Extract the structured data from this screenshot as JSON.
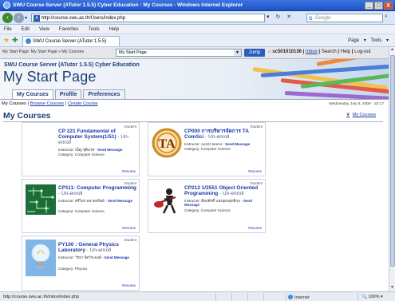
{
  "window": {
    "title": "SWU Course Server (ATutor 1.5.5) Cyber Education : My Courses - Windows Internet Explorer",
    "buttons": {
      "minimize": "_",
      "maximize": "□",
      "close": "X"
    }
  },
  "address": {
    "url": "http://course.swu.ac.th/Users/index.php",
    "search_placeholder": "Google"
  },
  "menu": [
    "File",
    "Edit",
    "View",
    "Favorites",
    "Tools",
    "Help"
  ],
  "favorites_bar": {
    "tab_label": "SWU Course Server (ATutor 1.5.5) Cyber Education (...",
    "commands": "Page ▾   Tools ▾"
  },
  "top_strip": {
    "breadcrumb": "My Start Page: My Start Page » My Courses",
    "jump_select_value": "My Start Page",
    "jump_button": "Jump",
    "username": "sc501010136",
    "links": [
      "Inbox",
      "Search",
      "Help",
      "Log-out"
    ]
  },
  "header": {
    "site_title": "SWU Course Server (ATutor 1.5.5) Cyber Education",
    "page_title": "My Start Page",
    "tabs": [
      "My Courses",
      "Profile",
      "Preferences"
    ]
  },
  "subnav": {
    "current": "My Courses",
    "links": [
      "Browse Courses",
      "Create Course"
    ],
    "date": "Wednesday July 8, 2009 - 23:17"
  },
  "main": {
    "title": "My Courses",
    "my_courses_link": "My Courses"
  },
  "courses": [
    {
      "role": "Student",
      "title": "CP 221 Fundamental of Computer System(1/51)",
      "unenroll": " - Un-enroll",
      "instructor": "Instructor: เพ็ญ ชุติมาศ - ",
      "send_message": "Send Message",
      "category": "Category: Computer Science",
      "resume": "Resume",
      "thumb": "none"
    },
    {
      "role": "Student",
      "title": "CP000 การบริหารจัดการ TA ComSci",
      "unenroll": " - Un-enroll",
      "instructor": "Instructor: cp101 teams - ",
      "send_message": "Send Message",
      "category": "Category: Computer Science",
      "resume": "Resume",
      "thumb": "ta-logo"
    },
    {
      "role": "Student",
      "title": "CP111: Computer Programming",
      "unenroll": " - Un-enroll",
      "instructor": "Instructor: ศรีไพร ฉลาดทรัพย์ - ",
      "send_message": "Send Message",
      "category": "Category: Computer Science",
      "resume": "Resume",
      "thumb": "circuit"
    },
    {
      "role": "Student",
      "title": "CP212 1/2551 Object Oriented Programming",
      "unenroll": " - Un-enroll",
      "instructor": "Instructor: ศิลปศักดิ์ แสงอุดมสุทธิกุล - ",
      "send_message": "Send Message",
      "category": "Category: Computer Science",
      "resume": "Resume",
      "thumb": "guitarist"
    },
    {
      "role": "Student",
      "title": "PY100 : General Physics Laboratory",
      "unenroll": " - Un-enroll",
      "instructor": "Instructor: วีรยา จิตวีระพงษ์ - ",
      "send_message": "Send Message",
      "category": "Category: Physics",
      "resume": "Resume",
      "thumb": "bulb"
    }
  ],
  "status": {
    "url": "http://course.swu.ac.th/inbox/index.php",
    "zone": "Internet",
    "zoom": "100%"
  },
  "colors": {
    "brand_blue": "#1f3f78",
    "link_blue": "#1a37a8",
    "title_bar": "#1f52c8"
  }
}
